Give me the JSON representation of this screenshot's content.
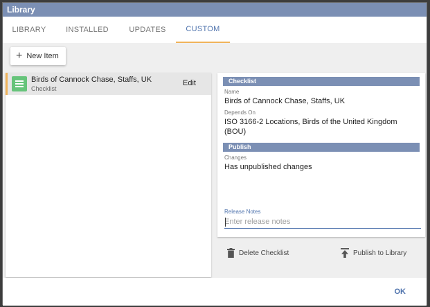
{
  "window": {
    "title": "Library"
  },
  "tabs": [
    {
      "label": "LIBRARY"
    },
    {
      "label": "INSTALLED"
    },
    {
      "label": "UPDATES"
    },
    {
      "label": "CUSTOM"
    }
  ],
  "toolbar": {
    "new_item_label": "New Item"
  },
  "list": {
    "items": [
      {
        "title": "Birds of Cannock Chase, Staffs, UK",
        "subtitle": "Checklist",
        "edit_label": "Edit"
      }
    ]
  },
  "detail": {
    "checklist_header": "Checklist",
    "name_label": "Name",
    "name_value": "Birds of Cannock Chase, Staffs, UK",
    "depends_label": "Depends On",
    "depends_value": "ISO 3166-2 Locations, Birds of the United Kingdom (BOU)",
    "publish_header": "Publish",
    "changes_label": "Changes",
    "changes_value": "Has unpublished changes",
    "release_notes_label": "Release Notes",
    "release_notes_placeholder": "Enter release notes",
    "release_notes_value": "",
    "delete_label": "Delete Checklist",
    "publish_label": "Publish to Library"
  },
  "footer": {
    "ok_label": "OK"
  },
  "colors": {
    "accent": "#4f73ad",
    "header_bar": "#7b8fb4",
    "tab_indicator": "#f0b35a",
    "checklist_icon": "#66c47a"
  },
  "icons": {
    "new_item": "plus-icon",
    "checklist": "list-icon",
    "delete": "trash-icon",
    "publish": "upload-icon"
  }
}
